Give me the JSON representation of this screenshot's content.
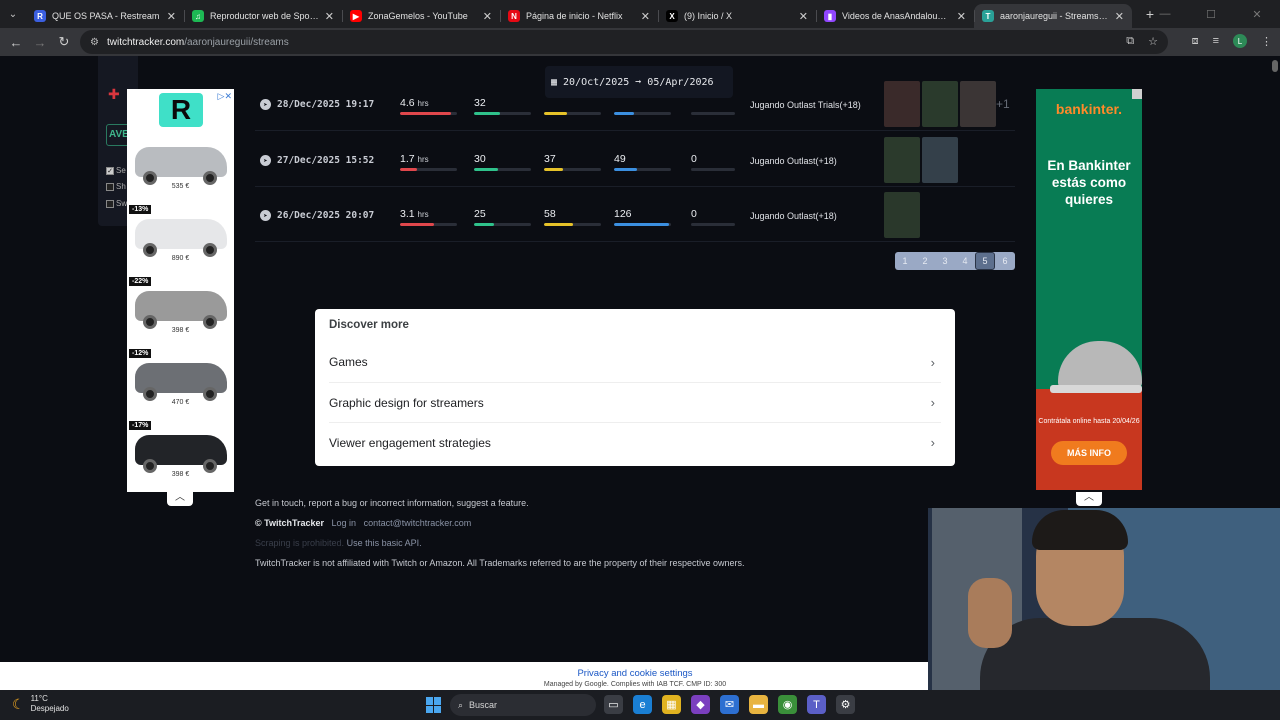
{
  "browser": {
    "tabs": [
      {
        "label": "QUE OS PASA - Restream",
        "icon": "restream-icon",
        "color": "#3b5fe0",
        "glyph": "R"
      },
      {
        "label": "Reproductor web de Spotify: m",
        "icon": "spotify-icon",
        "color": "#1db954",
        "glyph": "♫"
      },
      {
        "label": "ZonaGemelos - YouTube",
        "icon": "youtube-icon",
        "color": "#ff0000",
        "glyph": "▶"
      },
      {
        "label": "Página de inicio - Netflix",
        "icon": "netflix-icon",
        "color": "#e50914",
        "glyph": "N"
      },
      {
        "label": "(9) Inicio / X",
        "icon": "x-icon",
        "color": "#000000",
        "glyph": "X"
      },
      {
        "label": "Videos de AnasAndaloussi - Tw",
        "icon": "twitch-icon",
        "color": "#9146ff",
        "glyph": "▮"
      },
      {
        "label": "aaronjaureguii - Streams List a",
        "icon": "twitchtracker-icon",
        "color": "#2aa198",
        "glyph": "T"
      }
    ],
    "url_host": "twitchtracker.com",
    "url_path": "/aaronjaureguii/streams",
    "profile_initial": "L"
  },
  "date_range": {
    "from": "20/Oct/2025",
    "to": "05/Apr/2026"
  },
  "streams": [
    {
      "date": "28/Dec/2025 19:17",
      "duration": "4.6",
      "unit": "hrs",
      "avg": "32",
      "peak": "",
      "followers": "",
      "views": "",
      "title": "Jugando Outlast Trials(+18)",
      "thumbs": [
        "#3a2a2a",
        "#2a3a2c",
        "#3b3535"
      ],
      "plus": "+1"
    },
    {
      "date": "27/Dec/2025 15:52",
      "duration": "1.7",
      "unit": "hrs",
      "avg": "30",
      "peak": "37",
      "followers": "49",
      "views": "0",
      "title": "Jugando Outlast(+18)",
      "thumbs": [
        "#2b3a2c",
        "#34404a"
      ],
      "plus": ""
    },
    {
      "date": "26/Dec/2025 20:07",
      "duration": "3.1",
      "unit": "hrs",
      "avg": "25",
      "peak": "58",
      "followers": "126",
      "views": "0",
      "title": "Jugando Outlast(+18)",
      "thumbs": [
        "#2a382b"
      ],
      "plus": ""
    }
  ],
  "pagination": {
    "pages": [
      "1",
      "2",
      "3",
      "4",
      "5",
      "6"
    ],
    "current": "5"
  },
  "discover": {
    "heading": "Discover more",
    "items": [
      "Games",
      "Graphic design for streamers",
      "Viewer engagement strategies"
    ]
  },
  "footer": {
    "contact_line": "Get in touch, report a bug or incorrect information, suggest a feature.",
    "brand": "© TwitchTracker",
    "login": "Log in",
    "email": "contact@twitchtracker.com",
    "scraping": "Scraping is prohibited.",
    "api": "Use this basic API.",
    "disclaimer": "TwitchTracker is not affiliated with Twitch or Amazon. All Trademarks referred to are the property of their respective owners."
  },
  "left_ad": {
    "brand_glyph": "R",
    "cars": [
      {
        "discount": "",
        "price": "535 €",
        "color": "#b9bcc0"
      },
      {
        "discount": "-13%",
        "price": "890 €",
        "color": "#e6e7e9"
      },
      {
        "discount": "-22%",
        "price": "398 €",
        "color": "#9a9a9a"
      },
      {
        "discount": "-12%",
        "price": "470 €",
        "color": "#6c6f74"
      },
      {
        "discount": "-17%",
        "price": "398 €",
        "color": "#222428"
      }
    ]
  },
  "left_panel": {
    "badge": "AVE",
    "options": [
      "Se",
      "Sh",
      "Sw"
    ]
  },
  "right_ad": {
    "brand": "bankinter.",
    "headline": "En Bankinter estás como quieres",
    "small": "Contrátala online hasta 20/04/26",
    "cta": "MÁS INFO"
  },
  "privacy": {
    "link": "Privacy and cookie settings",
    "note": "Managed by Google. Complies with IAB TCF. CMP ID: 300"
  },
  "taskbar": {
    "temp": "11°C",
    "weather": "Despejado",
    "search": "Buscar"
  },
  "colors": {
    "duration_bar": "#e0474c",
    "avg_bar": "#2fc28b",
    "peak_bar": "#e6c229",
    "followers_bar": "#3b8fe0"
  }
}
